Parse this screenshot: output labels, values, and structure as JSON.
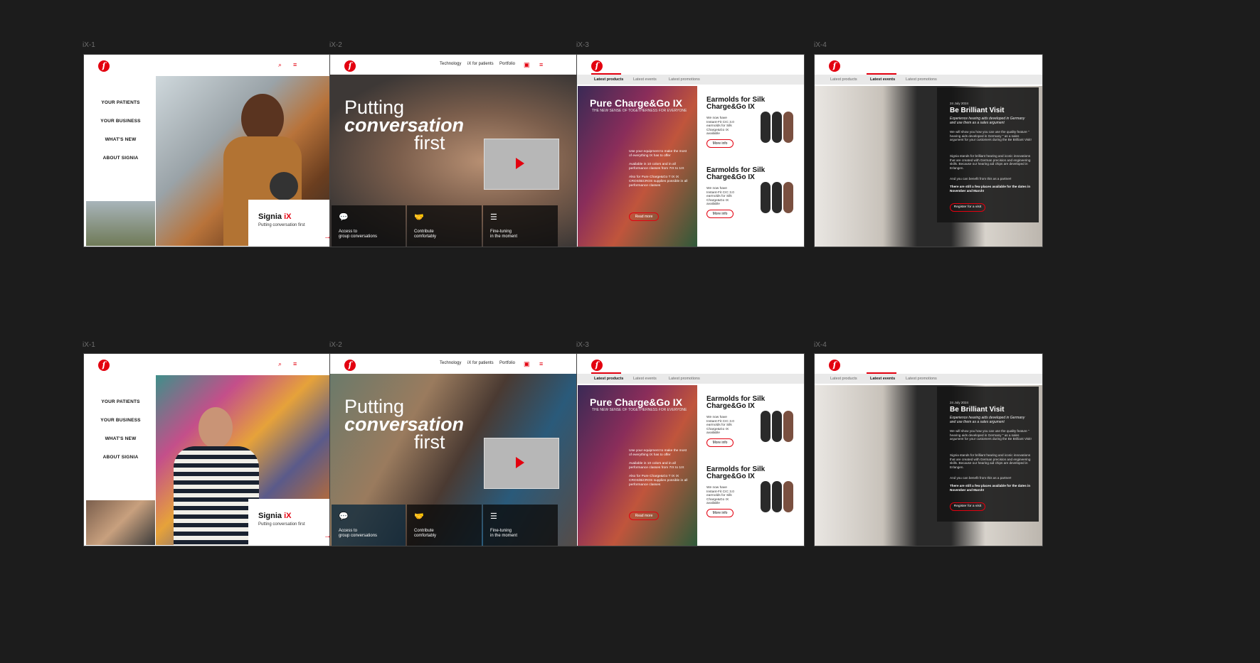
{
  "labels": [
    "iX-1",
    "iX-2",
    "iX-3",
    "iX-4"
  ],
  "ix1": {
    "menu": [
      "YOUR PATIENTS",
      "YOUR BUSINESS",
      "WHAT'S NEW",
      "ABOUT SIGNIA"
    ],
    "card_brand": "Signia ",
    "card_model": "iX",
    "card_sub": "Putting conversation first",
    "arrow": "→"
  },
  "ix2": {
    "nav": [
      "Technology",
      "iX for patients",
      "Portfolio"
    ],
    "title_1": "Putting",
    "title_2": "conversation",
    "title_3": "first",
    "features": [
      {
        "icon": "💬",
        "line1": "Access to",
        "line2": "group conversations"
      },
      {
        "icon": "🤝",
        "line1": "Contribute",
        "line2": "comfortably"
      },
      {
        "icon": "☰",
        "line1": "Fine-tuning",
        "line2": "in the moment"
      }
    ]
  },
  "ix3": {
    "tabs": [
      "Latest products",
      "Latest events",
      "Latest promotions"
    ],
    "promo_title": "Pure Charge&Go IX",
    "promo_sub": "THE NEW SENSE OF TOGETHERNESS FOR EVERYONE",
    "promo_p1": "Use your equipment to make the most of everything IX has to offer",
    "promo_p2": "Available in 10 colors and in all performance classes from 7IX to 1IX",
    "promo_p3": "Also for Pure Charge&Go T IX IX CROS/BiCROS supplies possible in all performance classes",
    "promo_btn": "Read more",
    "product_title": "Earmolds for Silk Charge&Go IX",
    "product_desc": "We now have Instant-Fit CIC 3.0 earmolds for Silk Charge&Go IX available",
    "product_btn": "More info"
  },
  "ix4": {
    "tabs": [
      "Latest products",
      "Latest events",
      "Latest promotions"
    ],
    "date": "24 July 2024",
    "title": "Be Brilliant Visit",
    "sub": "Experience hearing aids developed in Germany and use them as a sales argument",
    "p1": "We will show you how you can use the quality feature \" hearing aids developed in Germany \" as a sales argument for your customers during the Be Brilliant Visit!",
    "p2": "Signia stands for brilliant hearing and iconic innovations that are created with German precision and engineering skills. Because our hearing aid chips are developed in Erlangen.",
    "p3": "And you can benefit from this as a partner!",
    "p4": "There are still a few places available for the dates in November and March!",
    "btn": "Register for a visit"
  },
  "icons": {
    "logo": "ſ",
    "search": "⌕",
    "menu": "≡",
    "basket": "▣"
  },
  "colors": {
    "brand": "#e3000f",
    "bg": "#1c1c1c"
  }
}
